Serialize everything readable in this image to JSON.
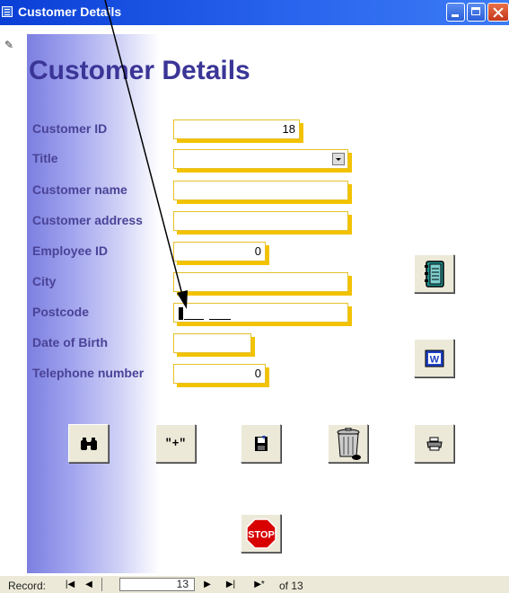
{
  "window": {
    "title": "Customer Details"
  },
  "form": {
    "heading": "Customer Details",
    "fields": {
      "customer_id": {
        "label": "Customer ID",
        "value": "18"
      },
      "title": {
        "label": "Title",
        "value": ""
      },
      "customer_name": {
        "label": "Customer name",
        "value": ""
      },
      "customer_address": {
        "label": "Customer address",
        "value": ""
      },
      "employee_id": {
        "label": "Employee ID",
        "value": "0"
      },
      "city": {
        "label": "City",
        "value": ""
      },
      "postcode": {
        "label": "Postcode",
        "value": ""
      },
      "date_of_birth": {
        "label": "Date of Birth",
        "value": ""
      },
      "telephone_number": {
        "label": "Telephone number",
        "value": "0"
      }
    },
    "buttons": {
      "plus_label": "\"+\"",
      "stop_label": "STOP"
    }
  },
  "record_nav": {
    "label": "Record:",
    "current": "13",
    "of_label": "of",
    "total": "13"
  },
  "colors": {
    "titlebar": "#0a3fd6",
    "heading": "#3a3596",
    "label": "#4a4398",
    "field_shadow": "#f2c200",
    "stop": "#d80000"
  },
  "icons": [
    "form-icon",
    "minimize-icon",
    "maximize-icon",
    "close-icon",
    "pencil-icon",
    "dropdown-arrow-icon",
    "address-book-icon",
    "word-icon",
    "binoculars-icon",
    "plus-icon",
    "save-icon",
    "trash-icon",
    "print-icon",
    "stop-icon",
    "first-record-icon",
    "prev-record-icon",
    "next-record-icon",
    "last-record-icon",
    "new-record-icon"
  ]
}
